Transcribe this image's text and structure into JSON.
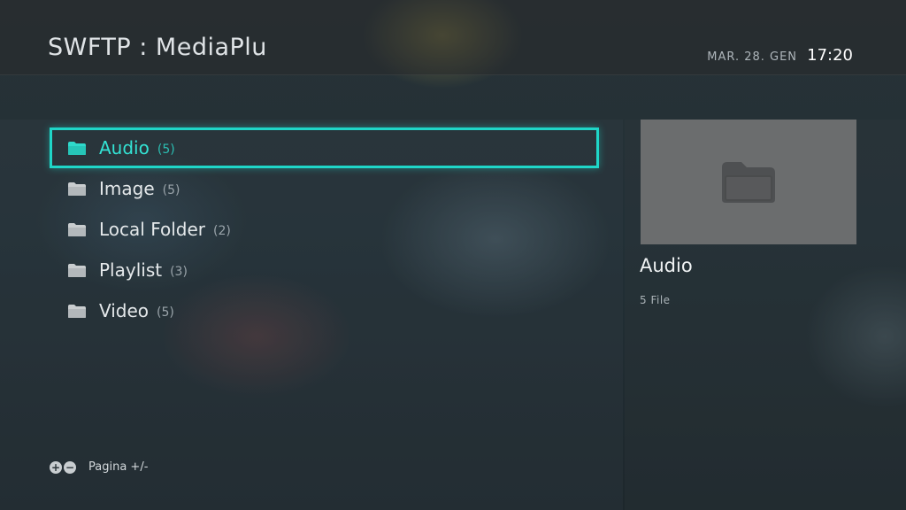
{
  "header": {
    "title": "SWFTP : MediaPlu",
    "date": "MAR. 28. GEN",
    "time": "17:20"
  },
  "list": {
    "items": [
      {
        "label": "Audio",
        "count": "(5)",
        "icon": "folder-icon",
        "selected": true
      },
      {
        "label": "Image",
        "count": "(5)",
        "icon": "folder-icon",
        "selected": false
      },
      {
        "label": "Local Folder",
        "count": "(2)",
        "icon": "folder-icon",
        "selected": false
      },
      {
        "label": "Playlist",
        "count": "(3)",
        "icon": "folder-icon",
        "selected": false
      },
      {
        "label": "Video",
        "count": "(5)",
        "icon": "folder-icon",
        "selected": false
      }
    ]
  },
  "detail": {
    "title": "Audio",
    "subtitle": "5 File",
    "thumbnail_icon": "folder-icon"
  },
  "footer": {
    "hint": "Pagina +/-",
    "icons": [
      "plus-icon",
      "minus-icon"
    ]
  },
  "colors": {
    "accent": "#1fd6c8",
    "selected_text": "#33e3d4"
  }
}
